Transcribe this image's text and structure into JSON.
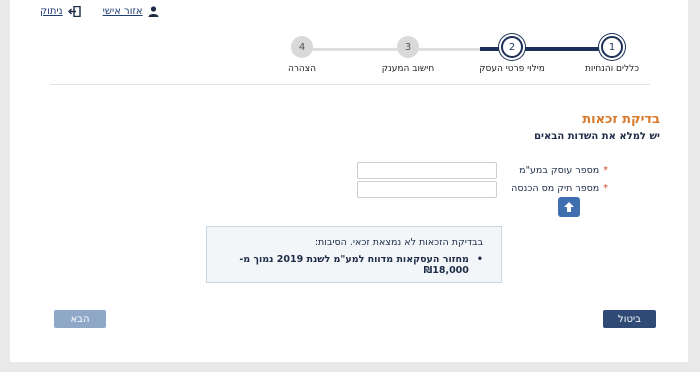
{
  "topbar": {
    "logout_label": "ניתוק",
    "personal_area_label": "אזור אישי"
  },
  "stepper": {
    "steps": [
      {
        "number": "1",
        "label": "כללים והנחיות",
        "state": "done"
      },
      {
        "number": "2",
        "label": "מילוי פרטי העסק",
        "state": "current"
      },
      {
        "number": "3",
        "label": "חישוב המענק",
        "state": "todo"
      },
      {
        "number": "4",
        "label": "הצהרה",
        "state": "todo"
      }
    ]
  },
  "form": {
    "title": "בדיקת זכאות",
    "subtitle": "יש למלא את השדות הבאים",
    "required_mark": "*",
    "fields": [
      {
        "label": "מספר עוסק במע\"מ",
        "value": ""
      },
      {
        "label": "מספר תיק מס הכנסה",
        "value": ""
      }
    ]
  },
  "notice": {
    "title": "בבדיקת הזכאות לא נמצאת זכאי. הסיבות:",
    "bullet": "•",
    "items": [
      "מחזור העסקאות מדווח למע\"מ לשנת 2019 נמוך מ- ₪18,000"
    ]
  },
  "buttons": {
    "next_label": "הבא",
    "cancel_label": "ביטול"
  },
  "colors": {
    "accent_title": "#d9792b",
    "primary": "#1d3158",
    "next_disabled": "#8fa8c8",
    "upload_button": "#3f6fae"
  },
  "icons": {
    "logout": "logout-icon",
    "user": "user-icon",
    "upload": "upload-arrow-icon"
  }
}
